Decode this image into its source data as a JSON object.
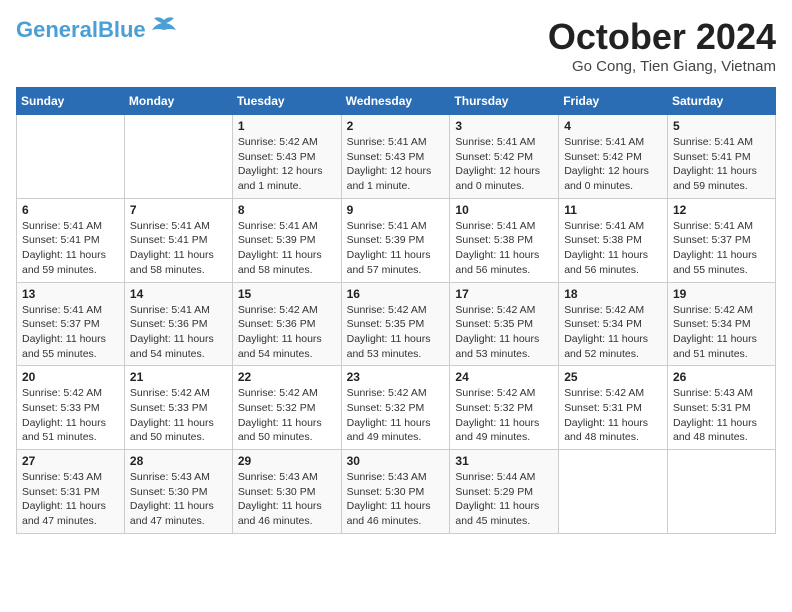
{
  "logo": {
    "line1": "General",
    "line2": "Blue"
  },
  "header": {
    "month": "October 2024",
    "location": "Go Cong, Tien Giang, Vietnam"
  },
  "weekdays": [
    "Sunday",
    "Monday",
    "Tuesday",
    "Wednesday",
    "Thursday",
    "Friday",
    "Saturday"
  ],
  "weeks": [
    [
      {
        "day": "",
        "info": ""
      },
      {
        "day": "",
        "info": ""
      },
      {
        "day": "1",
        "info": "Sunrise: 5:42 AM\nSunset: 5:43 PM\nDaylight: 12 hours\nand 1 minute."
      },
      {
        "day": "2",
        "info": "Sunrise: 5:41 AM\nSunset: 5:43 PM\nDaylight: 12 hours\nand 1 minute."
      },
      {
        "day": "3",
        "info": "Sunrise: 5:41 AM\nSunset: 5:42 PM\nDaylight: 12 hours\nand 0 minutes."
      },
      {
        "day": "4",
        "info": "Sunrise: 5:41 AM\nSunset: 5:42 PM\nDaylight: 12 hours\nand 0 minutes."
      },
      {
        "day": "5",
        "info": "Sunrise: 5:41 AM\nSunset: 5:41 PM\nDaylight: 11 hours\nand 59 minutes."
      }
    ],
    [
      {
        "day": "6",
        "info": "Sunrise: 5:41 AM\nSunset: 5:41 PM\nDaylight: 11 hours\nand 59 minutes."
      },
      {
        "day": "7",
        "info": "Sunrise: 5:41 AM\nSunset: 5:41 PM\nDaylight: 11 hours\nand 58 minutes."
      },
      {
        "day": "8",
        "info": "Sunrise: 5:41 AM\nSunset: 5:39 PM\nDaylight: 11 hours\nand 58 minutes."
      },
      {
        "day": "9",
        "info": "Sunrise: 5:41 AM\nSunset: 5:39 PM\nDaylight: 11 hours\nand 57 minutes."
      },
      {
        "day": "10",
        "info": "Sunrise: 5:41 AM\nSunset: 5:38 PM\nDaylight: 11 hours\nand 56 minutes."
      },
      {
        "day": "11",
        "info": "Sunrise: 5:41 AM\nSunset: 5:38 PM\nDaylight: 11 hours\nand 56 minutes."
      },
      {
        "day": "12",
        "info": "Sunrise: 5:41 AM\nSunset: 5:37 PM\nDaylight: 11 hours\nand 55 minutes."
      }
    ],
    [
      {
        "day": "13",
        "info": "Sunrise: 5:41 AM\nSunset: 5:37 PM\nDaylight: 11 hours\nand 55 minutes."
      },
      {
        "day": "14",
        "info": "Sunrise: 5:41 AM\nSunset: 5:36 PM\nDaylight: 11 hours\nand 54 minutes."
      },
      {
        "day": "15",
        "info": "Sunrise: 5:42 AM\nSunset: 5:36 PM\nDaylight: 11 hours\nand 54 minutes."
      },
      {
        "day": "16",
        "info": "Sunrise: 5:42 AM\nSunset: 5:35 PM\nDaylight: 11 hours\nand 53 minutes."
      },
      {
        "day": "17",
        "info": "Sunrise: 5:42 AM\nSunset: 5:35 PM\nDaylight: 11 hours\nand 53 minutes."
      },
      {
        "day": "18",
        "info": "Sunrise: 5:42 AM\nSunset: 5:34 PM\nDaylight: 11 hours\nand 52 minutes."
      },
      {
        "day": "19",
        "info": "Sunrise: 5:42 AM\nSunset: 5:34 PM\nDaylight: 11 hours\nand 51 minutes."
      }
    ],
    [
      {
        "day": "20",
        "info": "Sunrise: 5:42 AM\nSunset: 5:33 PM\nDaylight: 11 hours\nand 51 minutes."
      },
      {
        "day": "21",
        "info": "Sunrise: 5:42 AM\nSunset: 5:33 PM\nDaylight: 11 hours\nand 50 minutes."
      },
      {
        "day": "22",
        "info": "Sunrise: 5:42 AM\nSunset: 5:32 PM\nDaylight: 11 hours\nand 50 minutes."
      },
      {
        "day": "23",
        "info": "Sunrise: 5:42 AM\nSunset: 5:32 PM\nDaylight: 11 hours\nand 49 minutes."
      },
      {
        "day": "24",
        "info": "Sunrise: 5:42 AM\nSunset: 5:32 PM\nDaylight: 11 hours\nand 49 minutes."
      },
      {
        "day": "25",
        "info": "Sunrise: 5:42 AM\nSunset: 5:31 PM\nDaylight: 11 hours\nand 48 minutes."
      },
      {
        "day": "26",
        "info": "Sunrise: 5:43 AM\nSunset: 5:31 PM\nDaylight: 11 hours\nand 48 minutes."
      }
    ],
    [
      {
        "day": "27",
        "info": "Sunrise: 5:43 AM\nSunset: 5:31 PM\nDaylight: 11 hours\nand 47 minutes."
      },
      {
        "day": "28",
        "info": "Sunrise: 5:43 AM\nSunset: 5:30 PM\nDaylight: 11 hours\nand 47 minutes."
      },
      {
        "day": "29",
        "info": "Sunrise: 5:43 AM\nSunset: 5:30 PM\nDaylight: 11 hours\nand 46 minutes."
      },
      {
        "day": "30",
        "info": "Sunrise: 5:43 AM\nSunset: 5:30 PM\nDaylight: 11 hours\nand 46 minutes."
      },
      {
        "day": "31",
        "info": "Sunrise: 5:44 AM\nSunset: 5:29 PM\nDaylight: 11 hours\nand 45 minutes."
      },
      {
        "day": "",
        "info": ""
      },
      {
        "day": "",
        "info": ""
      }
    ]
  ]
}
